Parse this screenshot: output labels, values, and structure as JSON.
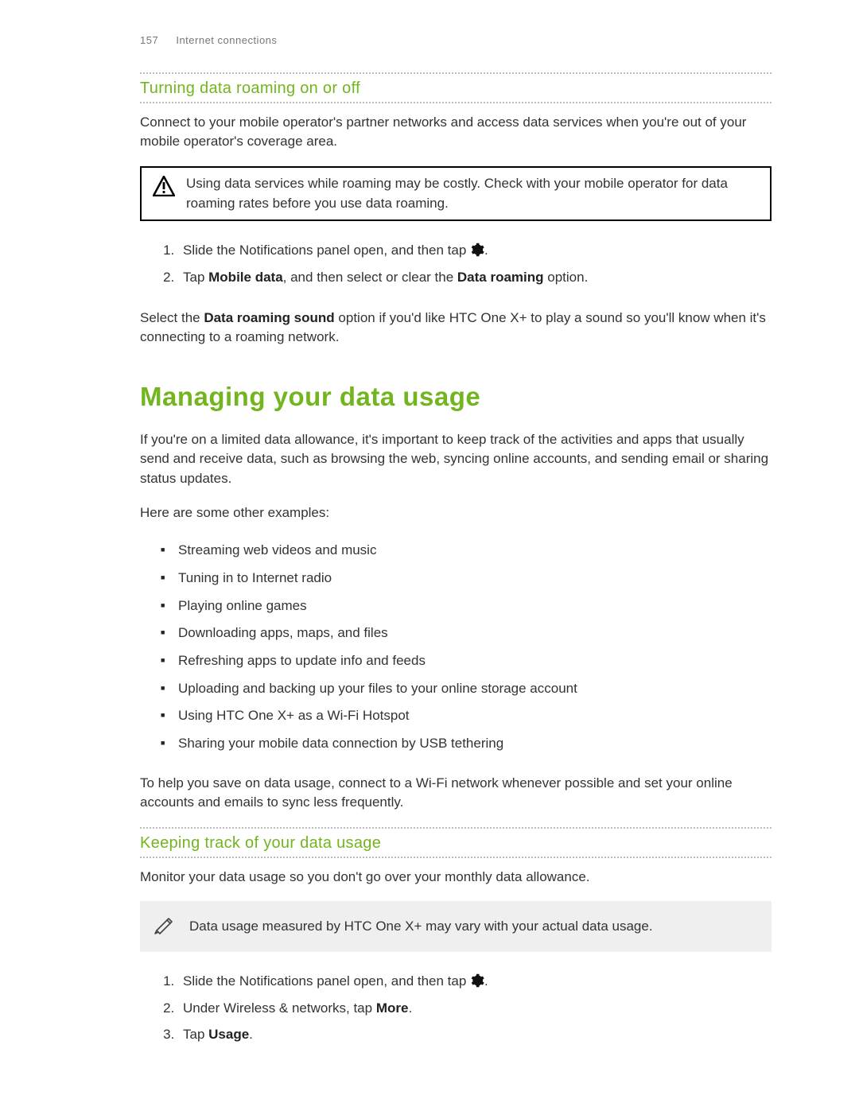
{
  "header": {
    "page_num": "157",
    "chapter": "Internet connections"
  },
  "sec1": {
    "title": "Turning data roaming on or off",
    "p1": "Connect to your mobile operator's partner networks and access data services when you're out of your mobile operator's coverage area.",
    "warn": "Using data services while roaming may be costly. Check with your mobile operator for data roaming rates before you use data roaming.",
    "step1_a": "Slide the Notifications panel open, and then tap ",
    "step1_b": ".",
    "step2_a": "Tap ",
    "step2_b": "Mobile data",
    "step2_c": ", and then select or clear the ",
    "step2_d": "Data roaming",
    "step2_e": " option.",
    "p2_a": "Select the ",
    "p2_b": "Data roaming sound",
    "p2_c": " option if you'd like HTC One X+ to play a sound so you'll know when it's connecting to a roaming network."
  },
  "sec2": {
    "title": "Managing your data usage",
    "p1": "If you're on a limited data allowance, it's important to keep track of the activities and apps that usually send and receive data, such as browsing the web, syncing online accounts, and sending email or sharing status updates.",
    "p2": "Here are some other examples:",
    "bullets": [
      "Streaming web videos and music",
      "Tuning in to Internet radio",
      "Playing online games",
      "Downloading apps, maps, and files",
      "Refreshing apps to update info and feeds",
      "Uploading and backing up your files to your online storage account",
      "Using HTC One X+ as a Wi-Fi Hotspot",
      "Sharing your mobile data connection by USB tethering"
    ],
    "p3": "To help you save on data usage, connect to a Wi-Fi network whenever possible and set your online accounts and emails to sync less frequently."
  },
  "sec3": {
    "title": "Keeping track of your data usage",
    "p1": "Monitor your data usage so you don't go over your monthly data allowance.",
    "note": "Data usage measured by HTC One X+ may vary with your actual data usage.",
    "step1_a": "Slide the Notifications panel open, and then tap ",
    "step1_b": ".",
    "step2_a": "Under Wireless & networks, tap ",
    "step2_b": "More",
    "step2_c": ".",
    "step3_a": "Tap ",
    "step3_b": "Usage",
    "step3_c": "."
  }
}
